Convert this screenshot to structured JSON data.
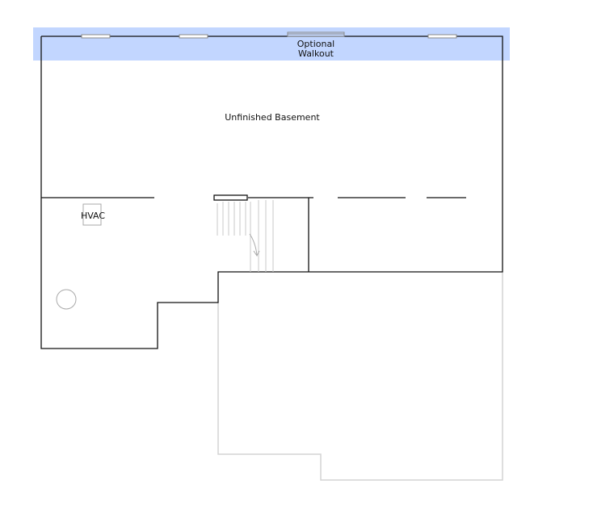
{
  "floor_plan": {
    "highlight_label": {
      "line1": "Optional",
      "line2": "Walkout"
    },
    "rooms": {
      "main": "Unfinished Basement"
    },
    "fixtures": {
      "hvac": "HVAC"
    },
    "colors": {
      "background": "#ffffff",
      "walls": "#111111",
      "ghost_outline": "#d4d4d4",
      "stairs": "#c9c9c9",
      "highlight": "#c2d6ff",
      "window": "#9a9a9a"
    }
  }
}
